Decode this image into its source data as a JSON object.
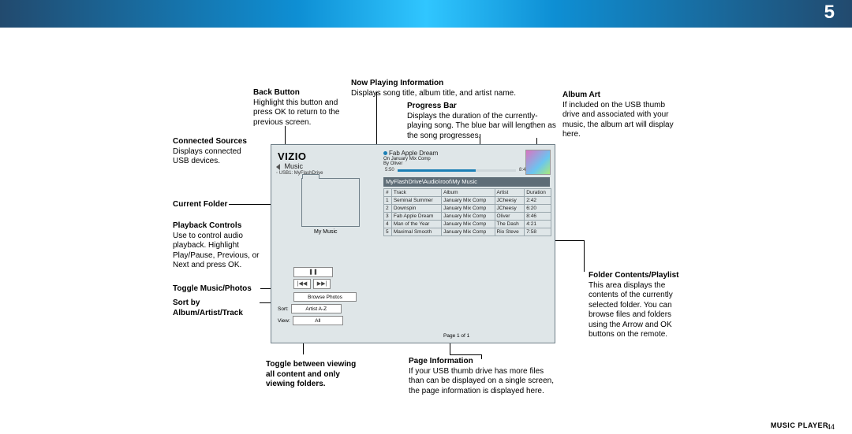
{
  "chapter": "5",
  "page_number": "44",
  "footer_label": "MUSIC PLAYER",
  "annotations": {
    "back": {
      "hd": "Back Button",
      "body": "Highlight this button and press OK to return to the previous screen."
    },
    "now_playing": {
      "hd": "Now Playing Information",
      "body": "Displays song title, album title, and artist name."
    },
    "progress": {
      "hd": "Progress Bar",
      "body": "Displays the duration of the currently-playing song. The blue bar will lengthen as the song progresses."
    },
    "album_art": {
      "hd": "Album Art",
      "body": "If included on the USB thumb drive and associated with your music, the album art will display here."
    },
    "connected": {
      "hd": "Connected Sources",
      "body": "Displays connected USB devices."
    },
    "current_folder": {
      "hd": "Current Folder"
    },
    "playback": {
      "hd": "Playback Controls",
      "body": "Use to control audio playback. Highlight Play/Pause, Previous, or Next and press OK."
    },
    "toggle_mp": {
      "hd": "Toggle Music/Photos"
    },
    "sort": {
      "hd": "Sort by Album/Artist/Track"
    },
    "toggle_view": {
      "hd": "Toggle between viewing all content and only viewing folders."
    },
    "pageinfo": {
      "hd": "Page Information",
      "body": "If your USB thumb drive has more files than can be displayed on a single screen, the page information is displayed here."
    },
    "folder_contents": {
      "hd": "Folder Contents/Playlist",
      "body": "This area displays the contents of the currently selected folder. You can browse files and folders using the Arrow and OK buttons on the remote."
    }
  },
  "ui": {
    "brand": "VIZIO",
    "back_label": "Music",
    "source": "USB1: MyFlashDrive",
    "np_title": "Fab Apple Dream",
    "np_album_prefix": "On",
    "np_album": "January Mix Comp",
    "np_artist_prefix": "By",
    "np_artist": "Oliver",
    "time_elapsed": "5:50",
    "time_total": "8:46",
    "folder_label": "My Music",
    "breadcrumb": "MyFlashDrive\\Audio\\root\\My Music",
    "cols": {
      "num": "#",
      "track": "Track",
      "album": "Album",
      "artist": "Artist",
      "dur": "Duration"
    },
    "tracks": [
      {
        "n": "1",
        "t": "Seminal Summer",
        "a": "January Mix Comp",
        "ar": "JCheesy",
        "d": "2:42"
      },
      {
        "n": "2",
        "t": "Downspin",
        "a": "January Mix Comp",
        "ar": "JCheesy",
        "d": "6:20"
      },
      {
        "n": "3",
        "t": "Fab Apple Dream",
        "a": "January Mix Comp",
        "ar": "Oliver",
        "d": "8:46"
      },
      {
        "n": "4",
        "t": "Man of the Year",
        "a": "January Mix Comp",
        "ar": "The Dash",
        "d": "4:21"
      },
      {
        "n": "5",
        "t": "Maximal Smooth",
        "a": "January Mix Comp",
        "ar": "Rio Steve",
        "d": "7:58"
      }
    ],
    "browse_label": "Browse Photos",
    "sort_label": "Sort:",
    "sort_value": "Artist A-Z",
    "view_label": "View:",
    "view_value": "All",
    "page_info": "Page 1 of 1"
  }
}
